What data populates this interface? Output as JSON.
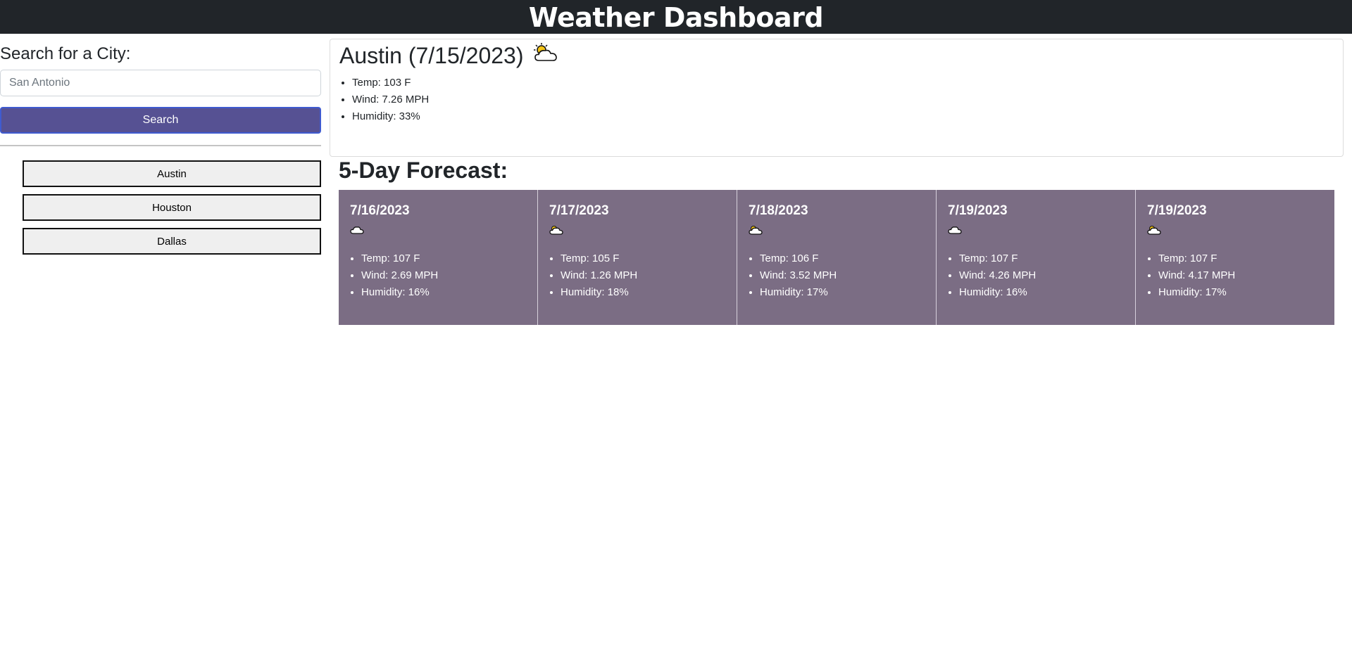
{
  "header": {
    "title": "Weather Dashboard"
  },
  "sidebar": {
    "search_label": "Search for a City:",
    "search_placeholder": "San Antonio",
    "search_button": "Search",
    "history": [
      "Austin",
      "Houston",
      "Dallas"
    ]
  },
  "current": {
    "title": "Austin (7/15/2023)",
    "icon": "sun-behind-cloud-icon",
    "temp": "Temp: 103 F",
    "wind": "Wind: 7.26 MPH",
    "humidity": "Humidity: 33%"
  },
  "forecast": {
    "heading": "5-Day Forecast:",
    "days": [
      {
        "date": "7/16/2023",
        "icon": "cloud-icon",
        "temp": "Temp: 107 F",
        "wind": "Wind: 2.69 MPH",
        "humidity": "Humidity: 16%"
      },
      {
        "date": "7/17/2023",
        "icon": "sun-behind-cloud-icon",
        "temp": "Temp: 105 F",
        "wind": "Wind: 1.26 MPH",
        "humidity": "Humidity: 18%"
      },
      {
        "date": "7/18/2023",
        "icon": "sun-behind-cloud-icon",
        "temp": "Temp: 106 F",
        "wind": "Wind: 3.52 MPH",
        "humidity": "Humidity: 17%"
      },
      {
        "date": "7/19/2023",
        "icon": "cloud-icon",
        "temp": "Temp: 107 F",
        "wind": "Wind: 4.26 MPH",
        "humidity": "Humidity: 16%"
      },
      {
        "date": "7/19/2023",
        "icon": "sun-behind-cloud-icon",
        "temp": "Temp: 107 F",
        "wind": "Wind: 4.17 MPH",
        "humidity": "Humidity: 17%"
      }
    ]
  },
  "colors": {
    "header_bg": "#212529",
    "search_button": "#565193",
    "forecast_card": "#7b6d84"
  }
}
